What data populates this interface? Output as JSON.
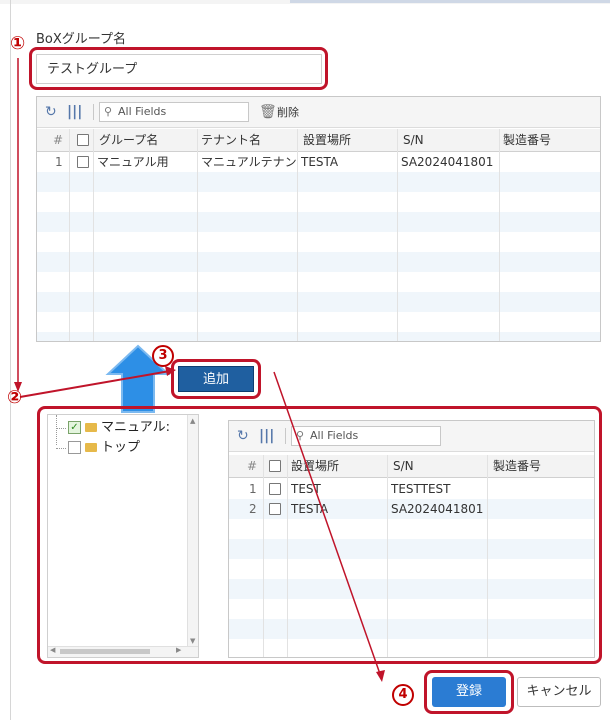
{
  "form": {
    "group_name_label": "BoXグループ名",
    "group_name_value": "テストグループ"
  },
  "top_grid": {
    "search_placeholder": "All Fields",
    "delete_label": "削除",
    "columns": [
      "#",
      "",
      "グループ名",
      "テナント名",
      "設置場所",
      "S/N",
      "製造番号"
    ],
    "rows": [
      {
        "num": "1",
        "group": "マニュアル用",
        "tenant": "マニュアルテナント",
        "location": "TESTA",
        "sn": "SA2024041801",
        "mfg": ""
      }
    ]
  },
  "add_button": "追加",
  "tree": {
    "items": [
      {
        "label": "マニュアル:",
        "checked": true
      },
      {
        "label": "トップ",
        "checked": false
      }
    ]
  },
  "bottom_grid": {
    "search_placeholder": "All Fields",
    "columns": [
      "#",
      "",
      "設置場所",
      "S/N",
      "製造番号"
    ],
    "rows": [
      {
        "num": "1",
        "location": "TEST",
        "sn": "TESTTEST",
        "mfg": ""
      },
      {
        "num": "2",
        "location": "TESTA",
        "sn": "SA2024041801",
        "mfg": ""
      }
    ]
  },
  "footer": {
    "register_label": "登録",
    "cancel_label": "キャンセル"
  },
  "annotations": {
    "step1": "①",
    "step2": "②",
    "step3": "3",
    "step4": "4"
  },
  "colors": {
    "annotation_red": "#c0142a",
    "primary_button": "#2b7cd3",
    "add_button": "#1f5fa0",
    "arrow_blue": "#2d8fe6"
  }
}
